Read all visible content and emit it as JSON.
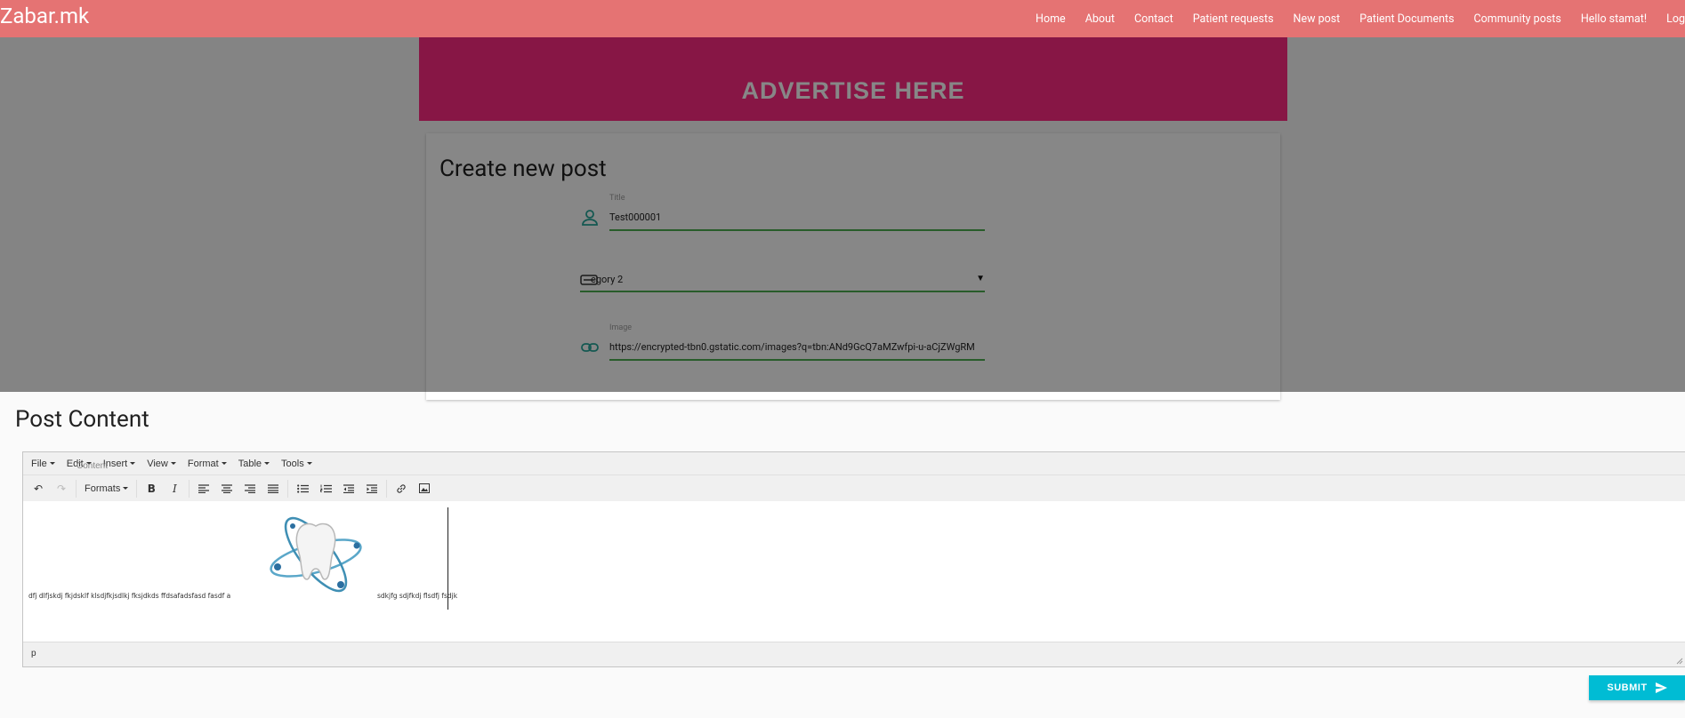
{
  "navbar": {
    "brand": "Zabar.mk",
    "links": [
      "Home",
      "About",
      "Contact",
      "Patient requests",
      "New post",
      "Patient Documents",
      "Community posts",
      "Hello stamat!",
      "Log"
    ]
  },
  "ad_banner": {
    "text": "ADVERTISE HERE"
  },
  "form": {
    "heading": "Create new post",
    "title_label": "Title",
    "title_value": "Test000001",
    "category_value": "egory 2",
    "image_label": "Image",
    "image_value": "https://encrypted-tbn0.gstatic.com/images?q=tbn:ANd9GcQ7aMZwfpi-u-aCjZWgRM"
  },
  "editor": {
    "section_title": "Post Content",
    "menu": [
      "File",
      "Edit",
      "Insert",
      "View",
      "Format",
      "Table",
      "Tools"
    ],
    "ghost_label": "Content",
    "formats_label": "Formats",
    "text_before_image": "dfj dlfjskdj fkjdsklf klsdjfkjsdlkj fksjdkds ffdsafadsfasd fasdf a",
    "text_after_image": "sdkjfg sdjfkdj flsdfj fsdjk",
    "status_path": "p"
  },
  "submit_label": "SUBMIT",
  "colors": {
    "navbar": "#e57373",
    "ad": "#ff2b83",
    "accent": "#26a69a",
    "underline": "#4caf50",
    "submit": "#00bcd4"
  }
}
